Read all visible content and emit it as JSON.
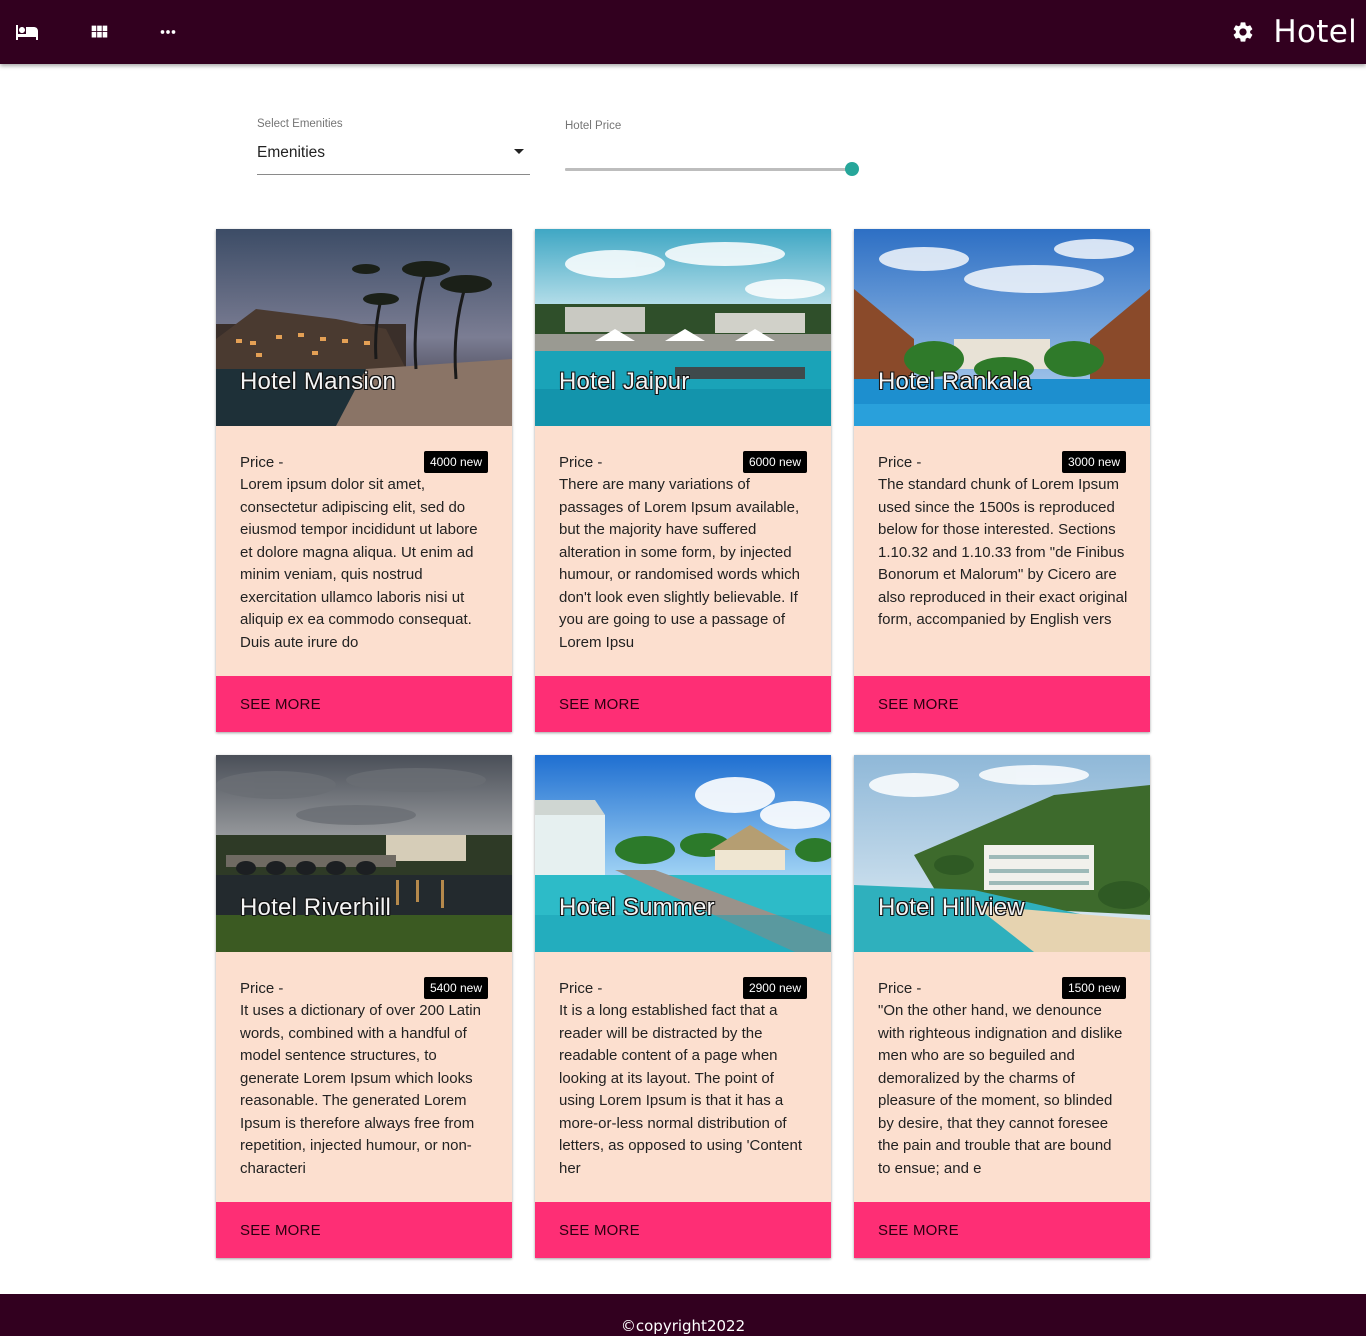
{
  "app": {
    "title": "Hotel"
  },
  "nav": {
    "icons": [
      "hotel-bed-icon",
      "grid-view-icon",
      "more-horiz-icon",
      "gear-icon"
    ]
  },
  "filters": {
    "amenities": {
      "label": "Select Emenities",
      "value": "Emenities"
    },
    "price": {
      "label": "Hotel Price",
      "level": 1.0
    }
  },
  "colors": {
    "header": "#32001f",
    "card": "#fcdfcf",
    "button": "#fe2e75",
    "slider_thumb": "#26a69a"
  },
  "hotels": [
    {
      "name": "Hotel Mansion",
      "price_label": "Price -",
      "badge": "4000 new",
      "description": "Lorem ipsum dolor sit amet, consectetur adipiscing elit, sed do eiusmod tempor incididunt ut labore et dolore magna aliqua. Ut enim ad minim veniam, quis nostrud exercitation ullamco laboris nisi ut aliquip ex ea commodo consequat. Duis aute irure do",
      "button": "SEE MORE"
    },
    {
      "name": "Hotel Jaipur",
      "price_label": "Price -",
      "badge": "6000 new",
      "description": "There are many variations of passages of Lorem Ipsum available, but the majority have suffered alteration in some form, by injected humour, or randomised words which don't look even slightly believable. If you are going to use a passage of Lorem Ipsu",
      "button": "SEE MORE"
    },
    {
      "name": "Hotel Rankala",
      "price_label": "Price -",
      "badge": "3000 new",
      "description": "The standard chunk of Lorem Ipsum used since the 1500s is reproduced below for those interested. Sections 1.10.32 and 1.10.33 from \"de Finibus Bonorum et Malorum\" by Cicero are also reproduced in their exact original form, accompanied by English vers",
      "button": "SEE MORE"
    },
    {
      "name": "Hotel Riverhill",
      "price_label": "Price -",
      "badge": "5400 new",
      "description": "It uses a dictionary of over 200 Latin words, combined with a handful of model sentence structures, to generate Lorem Ipsum which looks reasonable. The generated Lorem Ipsum is therefore always free from repetition, injected humour, or non-characteri",
      "button": "SEE MORE"
    },
    {
      "name": "Hotel Summer",
      "price_label": "Price -",
      "badge": "2900 new",
      "description": "It is a long established fact that a reader will be distracted by the readable content of a page when looking at its layout. The point of using Lorem Ipsum is that it has a more-or-less normal distribution of letters, as opposed to using 'Content her",
      "button": "SEE MORE"
    },
    {
      "name": "Hotel Hillview",
      "price_label": "Price -",
      "badge": "1500 new",
      "description": "\"On the other hand, we denounce with righteous indignation and dislike men who are so beguiled and demoralized by the charms of pleasure of the moment, so blinded by desire, that they cannot foresee the pain and trouble that are bound to ensue; and e",
      "button": "SEE MORE"
    }
  ],
  "footer": {
    "text": "©copyright2022"
  }
}
